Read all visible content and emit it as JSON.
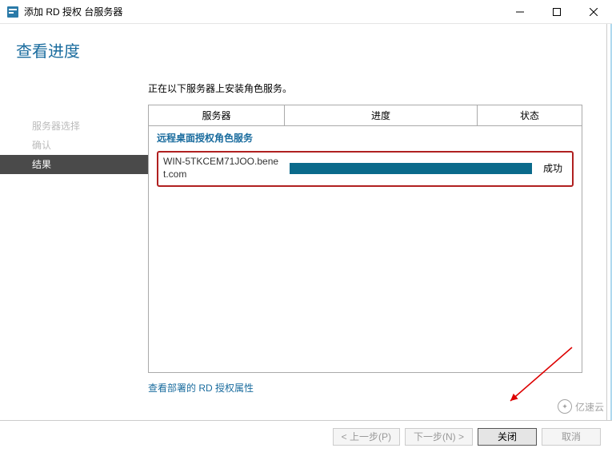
{
  "window": {
    "title": "添加 RD 授权 台服务器"
  },
  "page": {
    "heading": "查看进度",
    "instruction": "正在以下服务器上安装角色服务。"
  },
  "sidebar": {
    "items": [
      {
        "label": "服务器选择",
        "active": false,
        "disabled": true
      },
      {
        "label": "确认",
        "active": false,
        "disabled": true
      },
      {
        "label": "结果",
        "active": true,
        "disabled": false
      }
    ]
  },
  "table": {
    "columns": [
      "服务器",
      "进度",
      "状态"
    ],
    "role_service": "远程桌面授权角色服务",
    "rows": [
      {
        "server": "WIN-5TKCEM71JOO.benet.com",
        "progress": 100,
        "status": "成功"
      }
    ]
  },
  "link": {
    "view_properties": "查看部署的 RD 授权属性"
  },
  "footer": {
    "back": "< 上一步(P)",
    "next": "下一步(N) >",
    "close": "关闭",
    "cancel": "取消"
  },
  "watermark": {
    "text": "亿速云"
  }
}
